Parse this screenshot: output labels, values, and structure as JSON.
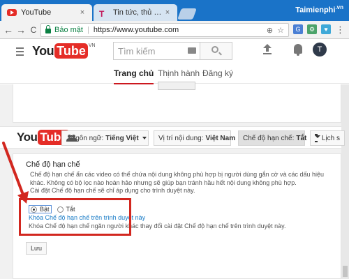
{
  "browser": {
    "tabs": [
      {
        "title": "YouTube",
        "close": "×"
      },
      {
        "title": "Tin tức, thủ thuật công n",
        "close": "×"
      }
    ],
    "brand": "Taimienphi",
    "brand_suffix": ".vn",
    "back": "←",
    "forward": "→",
    "reload": "C",
    "secure_label": "Bảo mật",
    "separator": "|",
    "url": "https://www.youtube.com",
    "zoom_icon": "⊕",
    "star_icon": "☆",
    "menu": "⋮"
  },
  "youtube": {
    "logo_you": "You",
    "logo_tube": "Tube",
    "logo_region": "VN",
    "search_placeholder": "Tìm kiếm",
    "avatar_letter": "T",
    "tabs": [
      "Trang chủ",
      "Thịnh hành",
      "Đăng ký"
    ]
  },
  "footer": {
    "language_label": "Ngôn ngữ:",
    "language_value": "Tiếng Việt",
    "location_label": "Vị trí nội dung:",
    "location_value": "Việt Nam",
    "restricted_label": "Chế độ hạn chế:",
    "restricted_value": "Tắt",
    "history_label": "Lịch s"
  },
  "panel": {
    "title": "Chế độ hạn chế",
    "description": "Chế độ hạn chế ẩn các video có thể chứa nội dung không phù hợp bị người dùng gắn cờ và các dấu hiệu khác. Không có bộ lọc nào hoàn hảo nhưng sẽ giúp bạn tránh hầu hết nội dung không phù hợp.",
    "note": "Cài đặt Chế độ hạn chế sẽ chỉ áp dụng cho trình duyệt này.",
    "option_on": "Bật",
    "option_off": "Tắt",
    "lock_link": "Khóa Chế độ hạn chế trên trình duyệt này",
    "lock_note": "Khóa Chế độ hạn chế ngăn người khác thay đổi cài đặt Chế độ hạn chế trên trình duyệt này.",
    "save_label": "Lưu"
  },
  "annotation": {
    "color": "#d2271f"
  }
}
